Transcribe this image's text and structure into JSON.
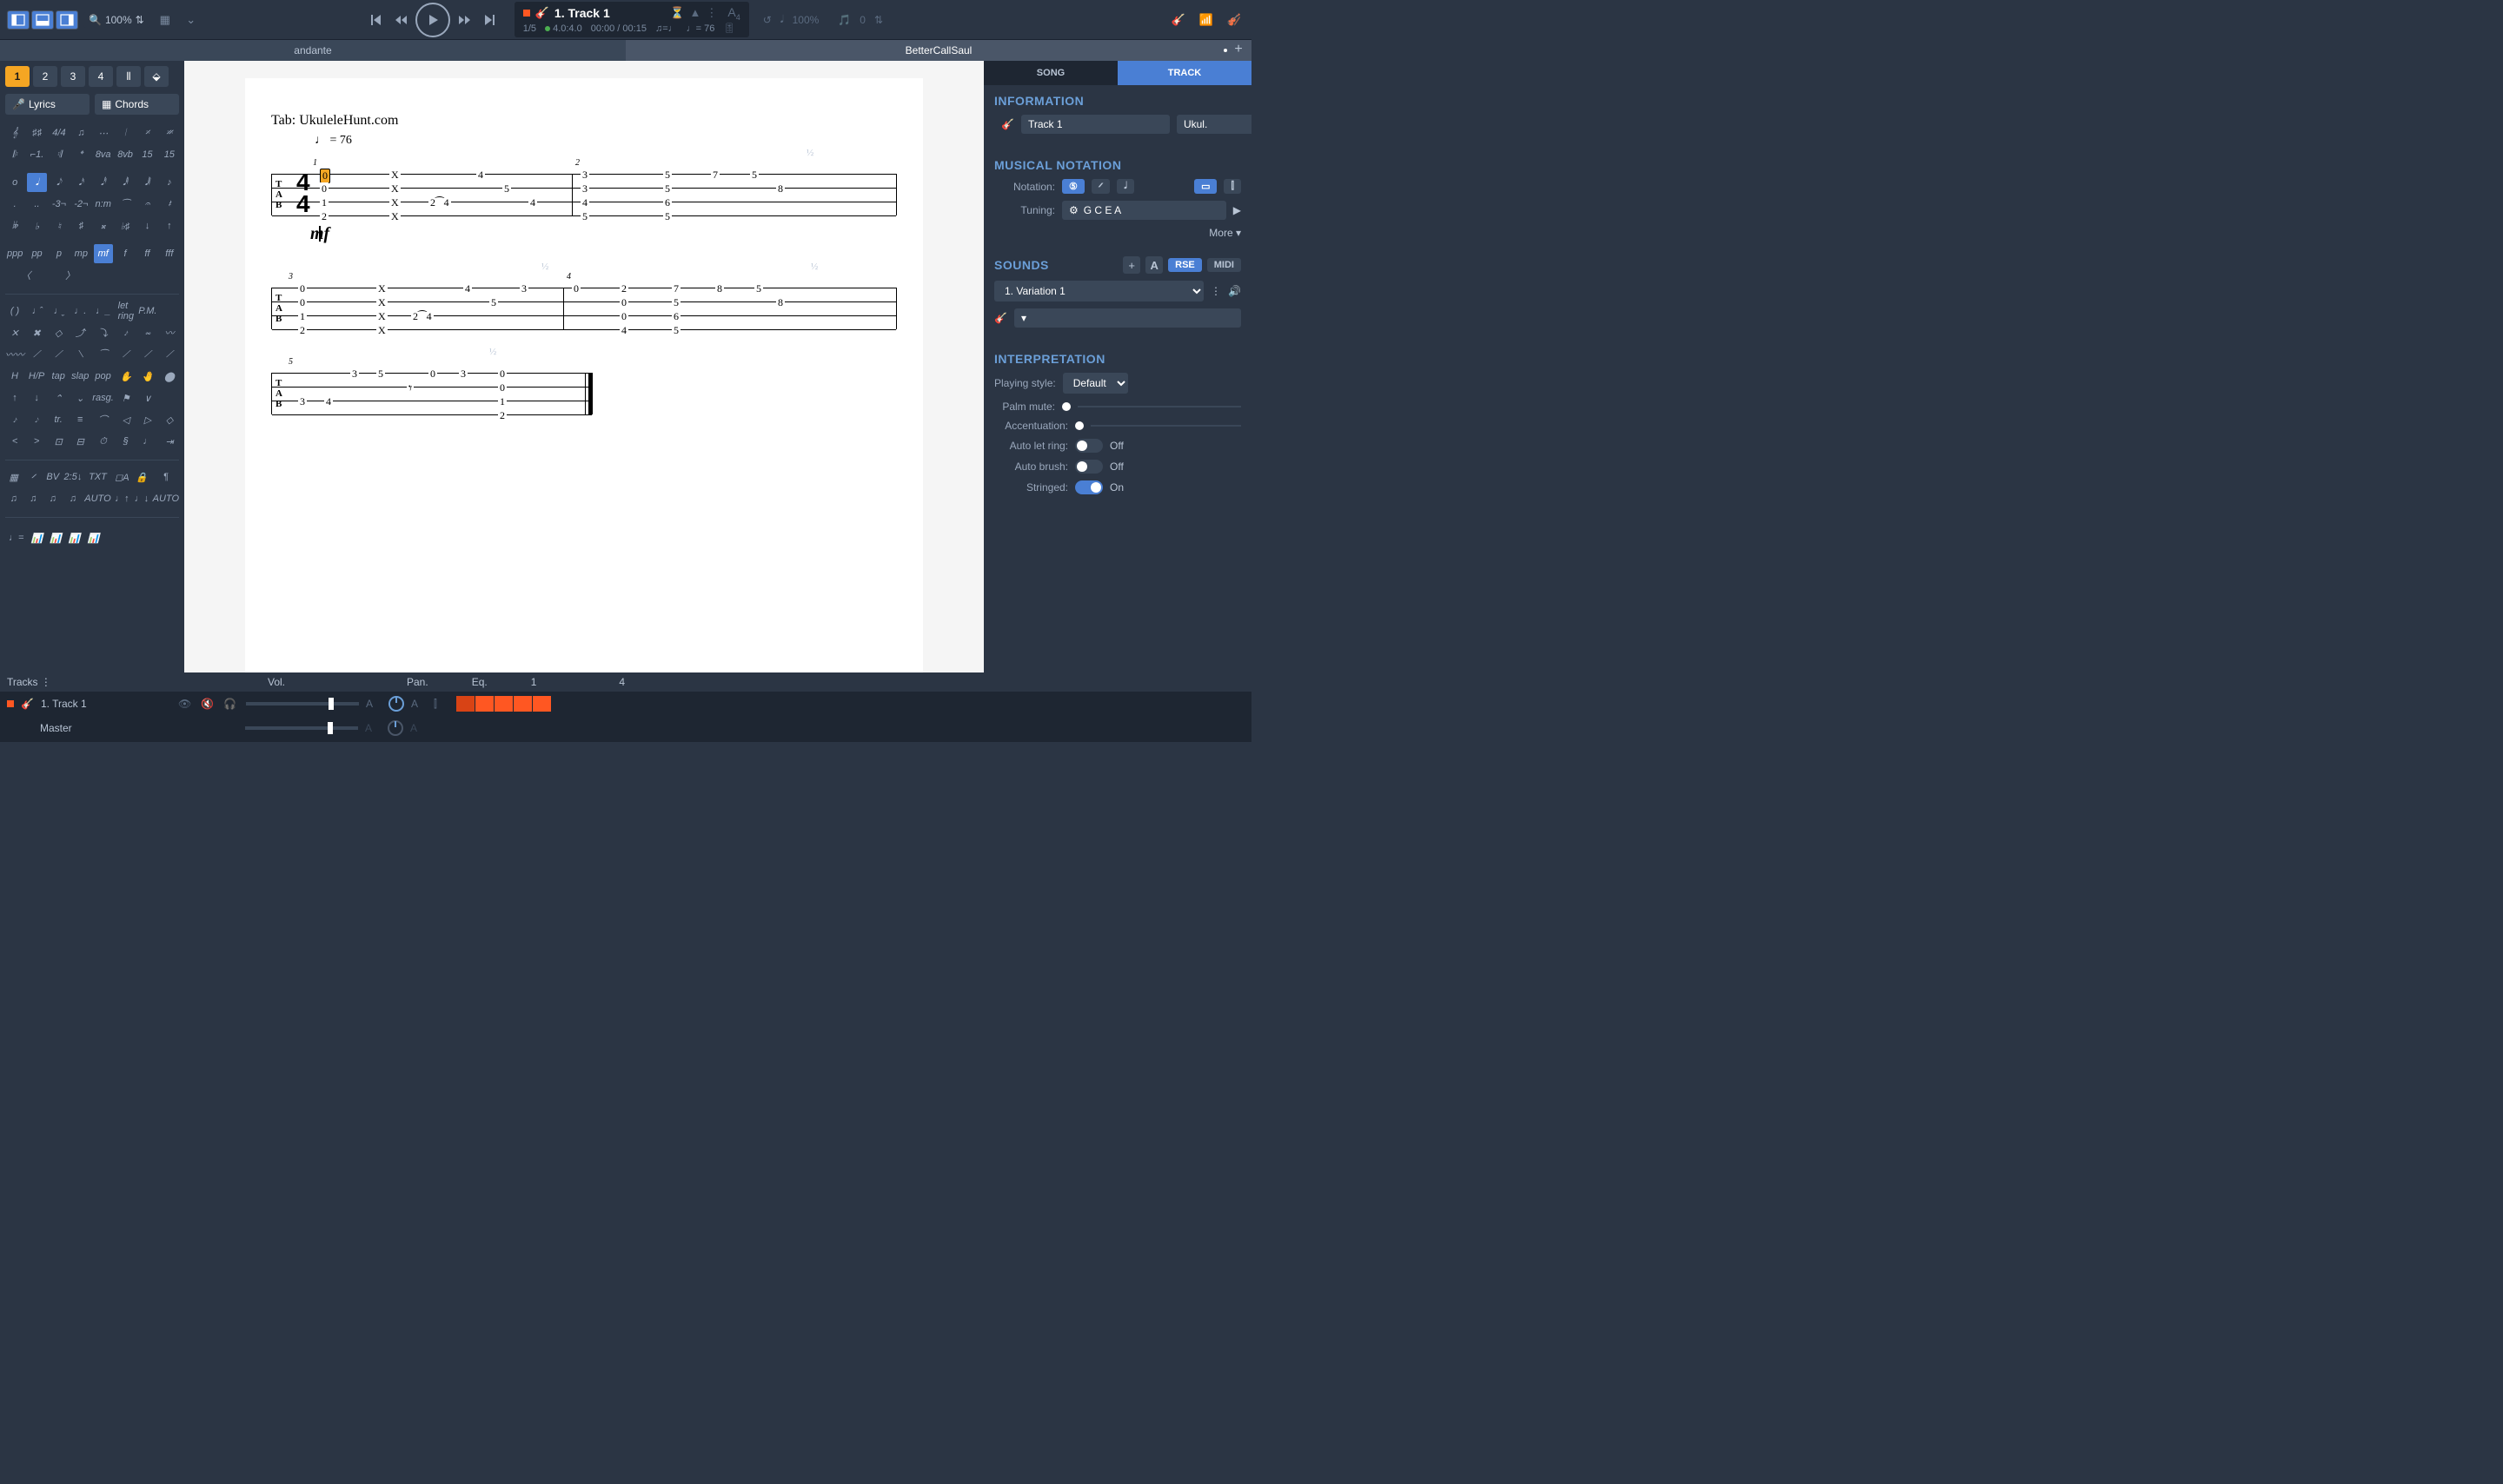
{
  "toolbar": {
    "zoom": "100%",
    "track_display": "1. Track 1",
    "page_info": "1/5",
    "position": "4.0:4.0",
    "time": "00:00 / 00:15",
    "tempo_display": "♩= 76",
    "speed": "100%",
    "transpose": "0"
  },
  "second_bar": {
    "left": "andante",
    "right": "BetterCallSaul"
  },
  "palette": {
    "voices": [
      "1",
      "2",
      "3",
      "4"
    ],
    "lyrics": "Lyrics",
    "chords": "Chords",
    "dynamics": [
      "ppp",
      "pp",
      "p",
      "mp",
      "mf",
      "f",
      "ff",
      "fff"
    ],
    "note_labels": [
      "o",
      "𝅝",
      "𝅗𝅥",
      "𝅘𝅥",
      "𝅘𝅥𝅮",
      "𝅘𝅥𝅯",
      "𝅘𝅥𝅰",
      "𝅘𝅥𝅱"
    ],
    "effects_row1": [
      "let ring",
      "P.M."
    ],
    "effects_row2": [
      "tap",
      "slap",
      "pop"
    ],
    "effects_row3": [
      "rasg."
    ],
    "bar_tools": [
      "BV",
      "2:5↓",
      "TXT"
    ]
  },
  "score": {
    "title": "Tab: UkuleleHunt.com",
    "tempo": "♩ = 76",
    "dynamic": "mf",
    "time_sig_num": "4",
    "time_sig_den": "4",
    "half_marker": "½"
  },
  "right_panel": {
    "tabs": [
      "SONG",
      "TRACK"
    ],
    "info_heading": "INFORMATION",
    "track_name": "Track 1",
    "track_short": "Ukul.",
    "notation_heading": "MUSICAL NOTATION",
    "notation_label": "Notation:",
    "tuning_label": "Tuning:",
    "tuning_value": "G C E A",
    "more": "More ▾",
    "sounds_heading": "SOUNDS",
    "sounds_rse": "RSE",
    "sounds_midi": "MIDI",
    "variation": "1. Variation 1",
    "interp_heading": "INTERPRETATION",
    "playing_style_label": "Playing style:",
    "playing_style_value": "Default",
    "palm_mute": "Palm mute:",
    "accentuation": "Accentuation:",
    "auto_let_ring": "Auto let ring:",
    "auto_let_ring_val": "Off",
    "auto_brush": "Auto brush:",
    "auto_brush_val": "Off",
    "stringed": "Stringed:",
    "stringed_val": "On"
  },
  "bottom": {
    "tracks_label": "Tracks",
    "vol": "Vol.",
    "pan": "Pan.",
    "eq": "Eq.",
    "bar1": "1",
    "bar4": "4",
    "track1_name": "1. Track 1",
    "master": "Master",
    "auto": "A"
  }
}
